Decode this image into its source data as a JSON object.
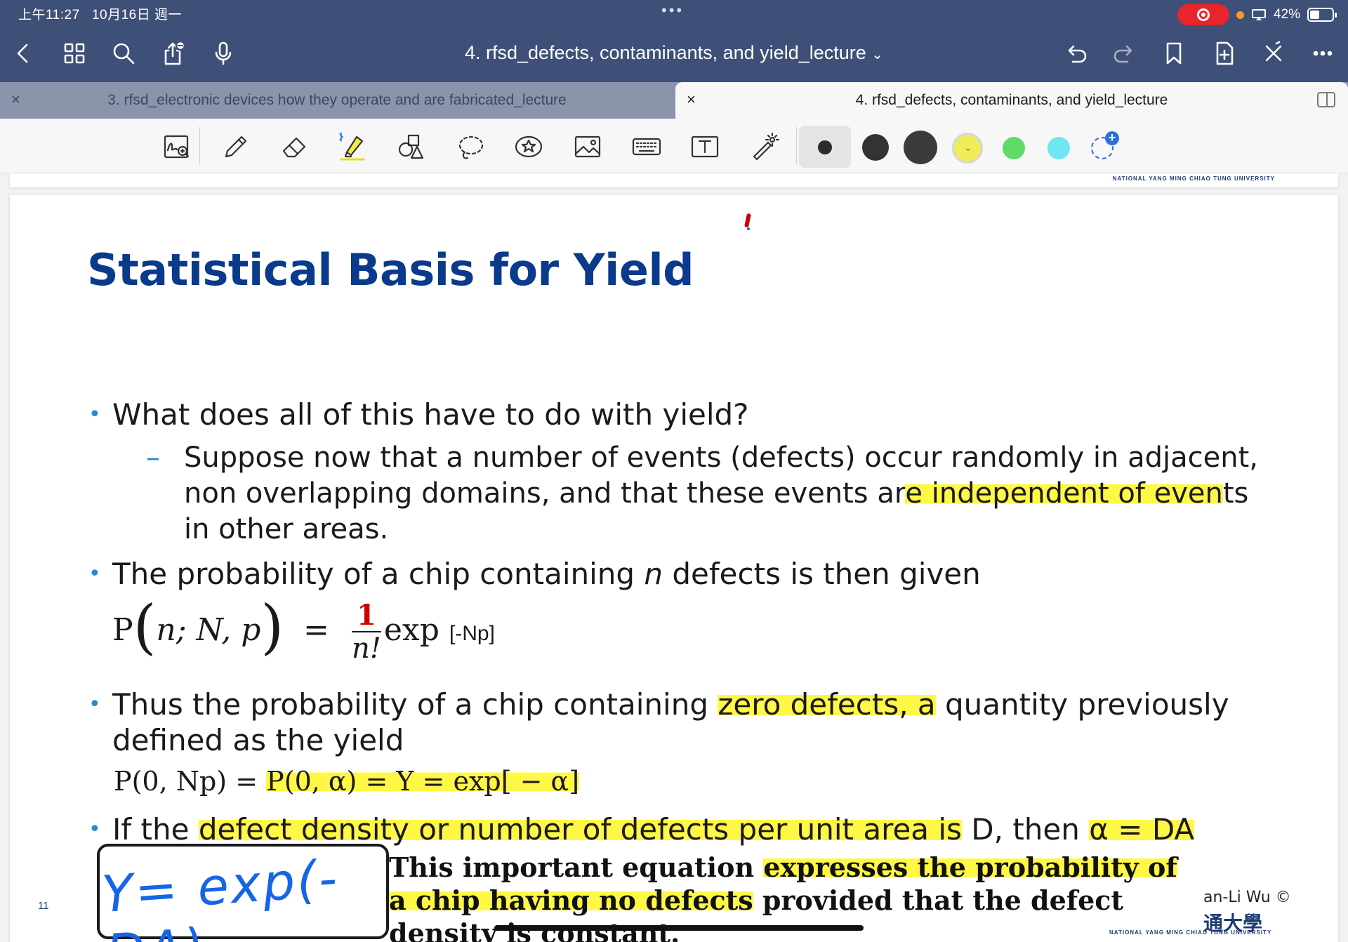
{
  "status_bar": {
    "time": "上午11:27",
    "date": "10月16日 週一",
    "battery": "42%",
    "battery_level": 0.42
  },
  "nav": {
    "document_title": "4. rfsd_defects, contaminants, and yield_lecture",
    "title_chevron": "⌄"
  },
  "tabs": [
    {
      "label": "3. rfsd_electronic devices how they operate and are fabricated_lecture",
      "active": false,
      "close": "×"
    },
    {
      "label": "4. rfsd_defects, contaminants, and yield_lecture",
      "active": true,
      "close": "×"
    }
  ],
  "toolbar": {
    "colors": [
      "#2b2b2b",
      "#333333",
      "#3a3a3a",
      "#f0ec5a",
      "#5fdb6a",
      "#6ee6f2"
    ],
    "add_color_badge": "+"
  },
  "slide": {
    "title": "Statistical Basis for Yield",
    "bullet1": "What does all of this have to do with yield?",
    "sub1": {
      "pre": "Suppose now that a number of events (defects) occur randomly in adjacent, non overlapping domains, and that these events ar",
      "hl": "e independent of even",
      "post": "ts in other areas."
    },
    "bullet2": {
      "pre": "The probability of a chip containing ",
      "var": "n",
      "post": " defects is then given"
    },
    "formula1": {
      "lhs_p": "P",
      "lhs_args": "n; N, p",
      "eq": "=",
      "numerator": "1",
      "denominator": "n!",
      "func": "exp",
      "arg": "[-Np]"
    },
    "bullet3": {
      "pre": "Thus the probability of a chip containing ",
      "hl": "zero defects, a",
      "post": " quantity previously defined as the yield"
    },
    "formula2": {
      "left": "P(0, Np)",
      "eq1": "=",
      "rest": "P(0, α) = Y = exp[ − α]"
    },
    "bullet4": {
      "pre": "If the ",
      "hl": "defect density or number of defects per unit area is",
      "mid": " D, then ",
      "hl2": "α = DA"
    },
    "handwriting": "Y= exp(-DA)",
    "note": {
      "p1": "This important equation ",
      "hl1": "expresses the probability of a chip having no defects",
      "p2": " provided that the defect density is constant."
    },
    "page_number": "11",
    "author": "an-Li Wu ©",
    "university_cn": "通大學",
    "university_en": "NATIONAL YANG MING CHIAO TUNG UNIVERSITY"
  }
}
